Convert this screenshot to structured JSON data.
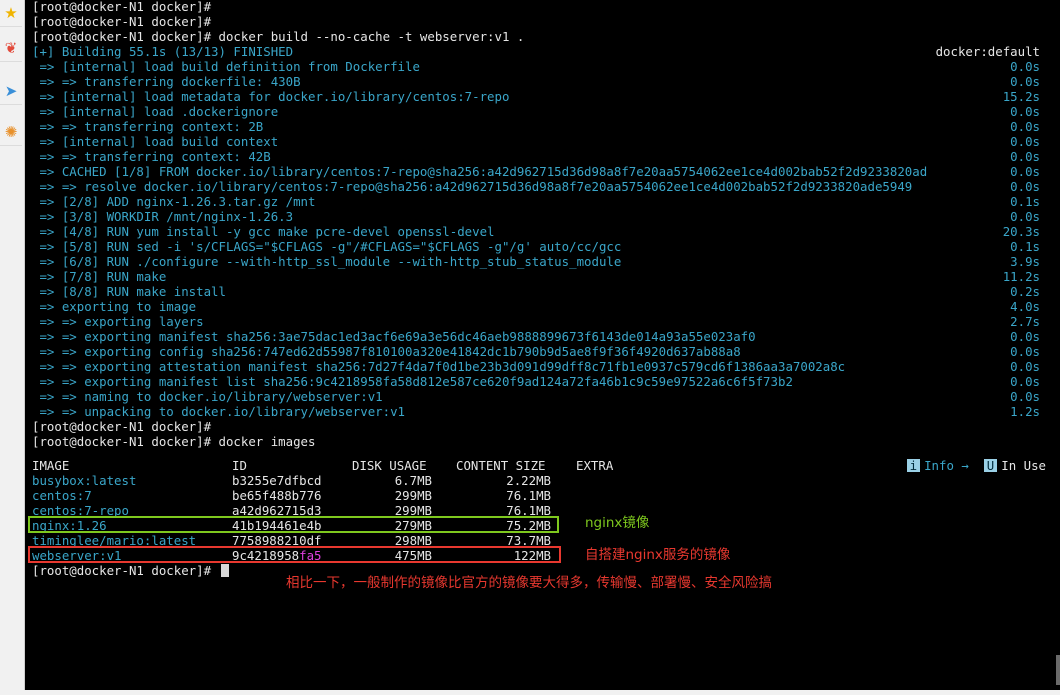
{
  "sidebar": {
    "icons": [
      "star-icon",
      "note-icon",
      "send-icon",
      "palette-icon"
    ]
  },
  "terminal": {
    "lines": [
      {
        "text": "[root@docker-N1 docker]#",
        "color": "white"
      },
      {
        "text": "[root@docker-N1 docker]#",
        "color": "white"
      },
      {
        "text": "[root@docker-N1 docker]# docker build --no-cache -t webserver:v1 .",
        "color": "white"
      },
      {
        "text": "[+] Building 55.1s (13/13) FINISHED",
        "color": "blue",
        "time": "docker:default",
        "time_color": "white"
      },
      {
        "text": " => [internal] load build definition from Dockerfile",
        "color": "blue",
        "time": "0.0s"
      },
      {
        "text": " => => transferring dockerfile: 430B",
        "color": "blue",
        "time": "0.0s"
      },
      {
        "text": " => [internal] load metadata for docker.io/library/centos:7-repo",
        "color": "blue",
        "time": "15.2s"
      },
      {
        "text": " => [internal] load .dockerignore",
        "color": "blue",
        "time": "0.0s"
      },
      {
        "text": " => => transferring context: 2B",
        "color": "blue",
        "time": "0.0s"
      },
      {
        "text": " => [internal] load build context",
        "color": "blue",
        "time": "0.0s"
      },
      {
        "text": " => => transferring context: 42B",
        "color": "blue",
        "time": "0.0s"
      },
      {
        "text": " => CACHED [1/8] FROM docker.io/library/centos:7-repo@sha256:a42d962715d36d98a8f7e20aa5754062ee1ce4d002bab52f2d9233820ad",
        "color": "blue",
        "time": "0.0s"
      },
      {
        "text": " => => resolve docker.io/library/centos:7-repo@sha256:a42d962715d36d98a8f7e20aa5754062ee1ce4d002bab52f2d9233820ade5949",
        "color": "blue",
        "time": "0.0s"
      },
      {
        "text": " => [2/8] ADD nginx-1.26.3.tar.gz /mnt",
        "color": "blue",
        "time": "0.1s"
      },
      {
        "text": " => [3/8] WORKDIR /mnt/nginx-1.26.3",
        "color": "blue",
        "time": "0.0s"
      },
      {
        "text": " => [4/8] RUN yum install -y gcc make pcre-devel openssl-devel",
        "color": "blue",
        "time": "20.3s"
      },
      {
        "text": " => [5/8] RUN sed -i 's/CFLAGS=\"$CFLAGS -g\"/#CFLAGS=\"$CFLAGS -g\"/g' auto/cc/gcc",
        "color": "blue",
        "time": "0.1s"
      },
      {
        "text": " => [6/8] RUN ./configure --with-http_ssl_module --with-http_stub_status_module",
        "color": "blue",
        "time": "3.9s"
      },
      {
        "text": " => [7/8] RUN make",
        "color": "blue",
        "time": "11.2s"
      },
      {
        "text": " => [8/8] RUN make install",
        "color": "blue",
        "time": "0.2s"
      },
      {
        "text": " => exporting to image",
        "color": "blue",
        "time": "4.0s"
      },
      {
        "text": " => => exporting layers",
        "color": "blue",
        "time": "2.7s"
      },
      {
        "text": " => => exporting manifest sha256:3ae75dac1ed3acf6e69a3e56dc46aeb9888899673f6143de014a93a55e023af0",
        "color": "blue",
        "time": "0.0s"
      },
      {
        "text": " => => exporting config sha256:747ed62d55987f810100a320e41842dc1b790b9d5ae8f9f36f4920d637ab88a8",
        "color": "blue",
        "time": "0.0s"
      },
      {
        "text": " => => exporting attestation manifest sha256:7d27f4da7f0d1be23b3d091d99dff8c71fb1e0937c579cd6f1386aa3a7002a8c",
        "color": "blue",
        "time": "0.0s"
      },
      {
        "text": " => => exporting manifest list sha256:9c4218958fa58d812e587ce620f9ad124a72fa46b1c9c59e97522a6c6f5f73b2",
        "color": "blue",
        "time": "0.0s"
      },
      {
        "text": " => => naming to docker.io/library/webserver:v1",
        "color": "blue",
        "time": "0.0s"
      },
      {
        "text": " => => unpacking to docker.io/library/webserver:v1",
        "color": "blue",
        "time": "1.2s"
      },
      {
        "text": "[root@docker-N1 docker]#",
        "color": "white"
      },
      {
        "text": "[root@docker-N1 docker]# docker images",
        "color": "white"
      }
    ],
    "status_bar": {
      "info_tag": "i",
      "info_text": "Info →",
      "use_tag": "U",
      "use_text": "In Use"
    },
    "images_table": {
      "headers": [
        "IMAGE",
        "ID",
        "DISK USAGE",
        "CONTENT SIZE",
        "EXTRA"
      ],
      "rows": [
        {
          "image": "busybox:latest",
          "id": "b3255e7dfbcd",
          "id_suffix": "",
          "disk": "6.7MB",
          "content": "2.22MB"
        },
        {
          "image": "centos:7",
          "id": "be65f488b776",
          "id_suffix": "",
          "disk": "299MB",
          "content": "76.1MB"
        },
        {
          "image": "centos:7-repo",
          "id": "a42d962715d3",
          "id_suffix": "",
          "disk": "299MB",
          "content": "76.1MB"
        },
        {
          "image": "nginx:1.26",
          "id": "41b194461e4b",
          "id_suffix": "",
          "disk": "279MB",
          "content": "75.2MB"
        },
        {
          "image": "timinglee/mario:latest",
          "id": "7758988210df",
          "id_suffix": "",
          "disk": "298MB",
          "content": "73.7MB"
        },
        {
          "image": "webserver:v1",
          "id": "9c4218958",
          "id_suffix": "fa5",
          "disk": "475MB",
          "content": "122MB"
        }
      ]
    },
    "final_prompt": "[root@docker-N1 docker]#"
  },
  "annotations": {
    "nginx_label": "nginx镜像",
    "webserver_label": "自搭建nginx服务的镜像",
    "summary": "相比一下，一般制作的镜像比官方的镜像要大得多，传输慢、部署慢、安全风险搞",
    "colors": {
      "green": "#7ec81e",
      "red": "#e8382f"
    }
  }
}
